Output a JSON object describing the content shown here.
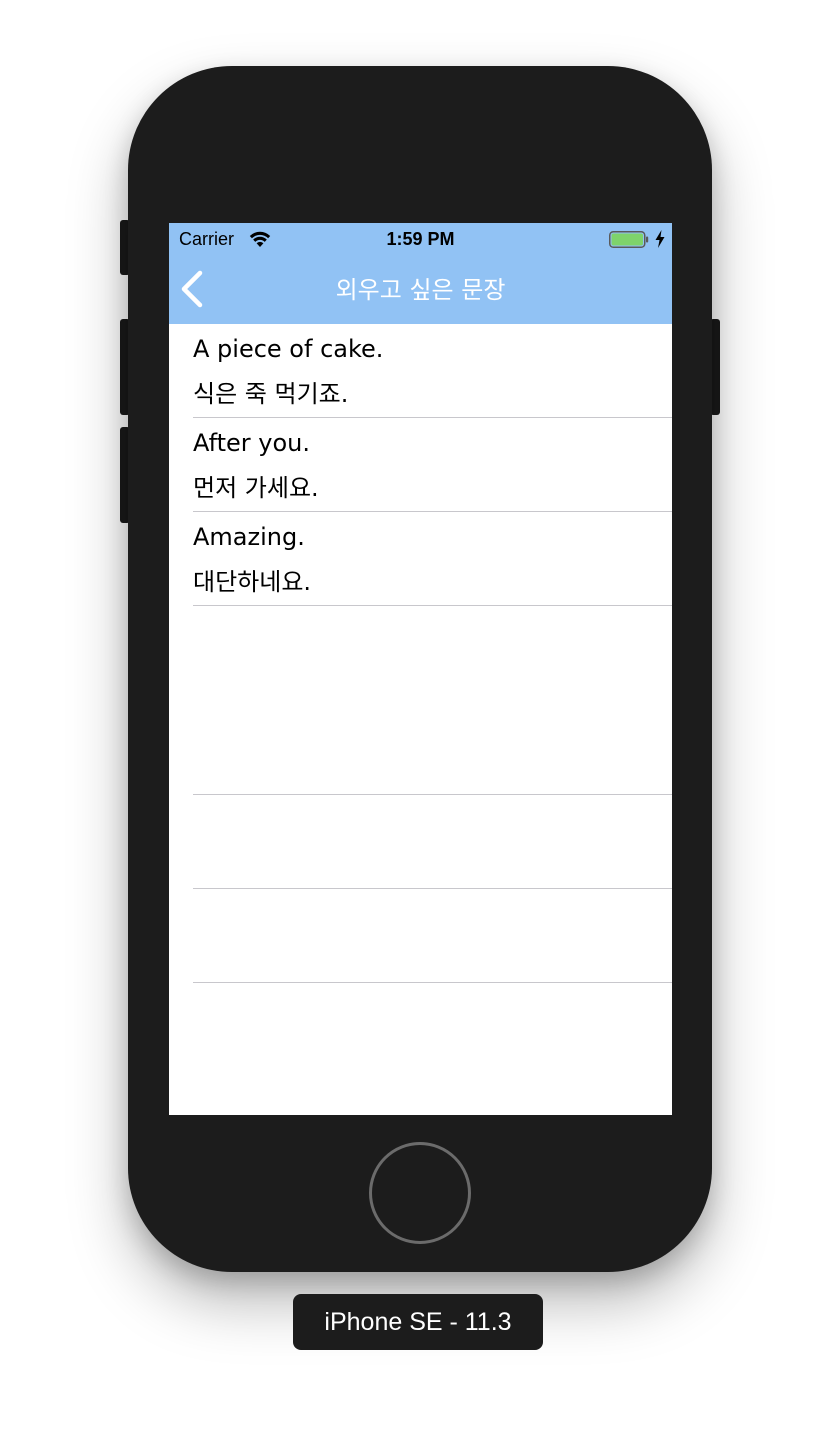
{
  "device_label": "iPhone SE - 11.3",
  "status_bar": {
    "carrier": "Carrier",
    "time": "1:59 PM",
    "icons": [
      "wifi-icon",
      "battery-icon",
      "charging-bolt-icon"
    ]
  },
  "nav_bar": {
    "title": "외우고 싶은 문장",
    "back_icon": "chevron-left-icon"
  },
  "phrases": [
    {
      "english": "A piece of cake.",
      "korean": "식은 죽 먹기죠."
    },
    {
      "english": "After you.",
      "korean": "먼저 가세요."
    },
    {
      "english": "Amazing.",
      "korean": "대단하네요."
    }
  ],
  "colors": {
    "nav_background": "#91c2f4",
    "nav_text": "#ffffff",
    "battery_fill": "#7ed36b",
    "separator": "#c8c7cc",
    "device_body": "#1c1c1c"
  }
}
